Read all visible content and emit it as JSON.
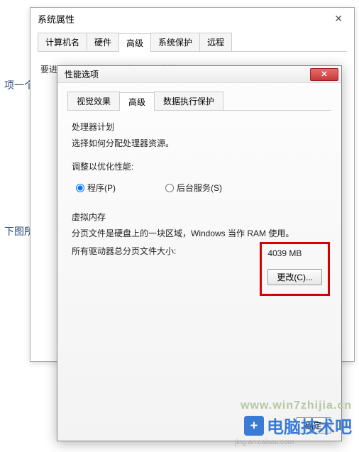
{
  "back_window": {
    "title": "系统属性",
    "tabs": [
      "计算机名",
      "硬件",
      "高级",
      "系统保护",
      "远程"
    ],
    "active_tab_index": 2,
    "hint": "要进行上々教设置工，你以否作也管理具珍寻"
  },
  "front_window": {
    "title": "性能选项",
    "tabs": [
      "视觉效果",
      "高级",
      "数据执行保护"
    ],
    "active_tab_index": 1,
    "processor": {
      "heading": "处理器计划",
      "desc": "选择如何分配处理器资源。",
      "optimize_label": "调整以优化性能:",
      "radio_programs": "程序(P)",
      "radio_services": "后台服务(S)"
    },
    "virtual_memory": {
      "heading": "虚拟内存",
      "desc": "分页文件是硬盘上的一块区域，Windows 当作 RAM 使用。",
      "total_label": "所有驱动器总分页文件大小:",
      "total_value": "4039 MB",
      "change_button": "更改(C)..."
    },
    "ok_button": "确定"
  },
  "fragments": {
    "left1": "项一个",
    "left2": "下图所"
  },
  "watermark": {
    "url": "www.win7zhijia.cn",
    "brand": "电脑技术吧",
    "sub": "jing.an.caisou.com"
  }
}
